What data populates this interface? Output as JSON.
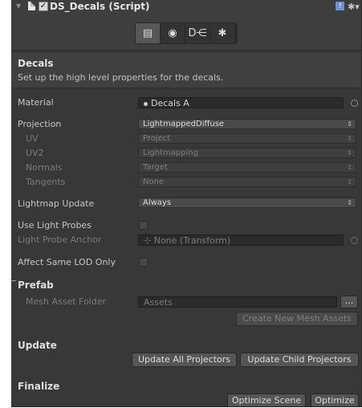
{
  "header": {
    "expand_glyph": "▼",
    "title": "DS_Decals (Script)",
    "help_icon": "book-icon",
    "settings_icon": "gear-icon",
    "toolbar": [
      {
        "icon": "inspector-icon",
        "glyph": "▤",
        "selected": true
      },
      {
        "icon": "lightprobe-icon",
        "glyph": "◉",
        "selected": false
      },
      {
        "icon": "decal-projector-icon",
        "glyph": "D⋲",
        "selected": false
      },
      {
        "icon": "settings-gear-icon",
        "glyph": "✱",
        "selected": false
      }
    ]
  },
  "section": {
    "title": "Decals",
    "description": "Set up the high level properties for the decals."
  },
  "props": {
    "material_label": "Material",
    "material_value": "Decals A",
    "projection_label": "Projection",
    "projection_value": "LightmappedDiffuse",
    "uv_label": "UV",
    "uv_value": "Project",
    "uv2_label": "UV2",
    "uv2_value": "Lightmapping",
    "normals_label": "Normals",
    "normals_value": "Target",
    "tangents_label": "Tangents",
    "tangents_value": "None",
    "lightmap_update_label": "Lightmap Update",
    "lightmap_update_value": "Always",
    "use_light_probes_label": "Use Light Probes",
    "light_probe_anchor_label": "Light Probe Anchor",
    "light_probe_anchor_value": "None (Transform)",
    "affect_same_lod_label": "Affect Same LOD Only"
  },
  "prefab": {
    "title": "Prefab",
    "mesh_asset_folder_label": "Mesh Asset Folder",
    "mesh_asset_folder_value": "Assets",
    "browse_label": "...",
    "create_mesh_assets_label": "Create New Mesh Assets"
  },
  "update": {
    "title": "Update",
    "update_all_label": "Update All Projectors",
    "update_child_label": "Update Child Projectors"
  },
  "finalize": {
    "title": "Finalize",
    "optimize_scene_label": "Optimize Scene",
    "optimize_label": "Optimize"
  },
  "colors": {
    "panel": "#383838",
    "field": "#2b2b2b",
    "text": "#c6c6c6",
    "dim_text": "#7a7a7a",
    "help_icon": "#6b8fd6"
  }
}
